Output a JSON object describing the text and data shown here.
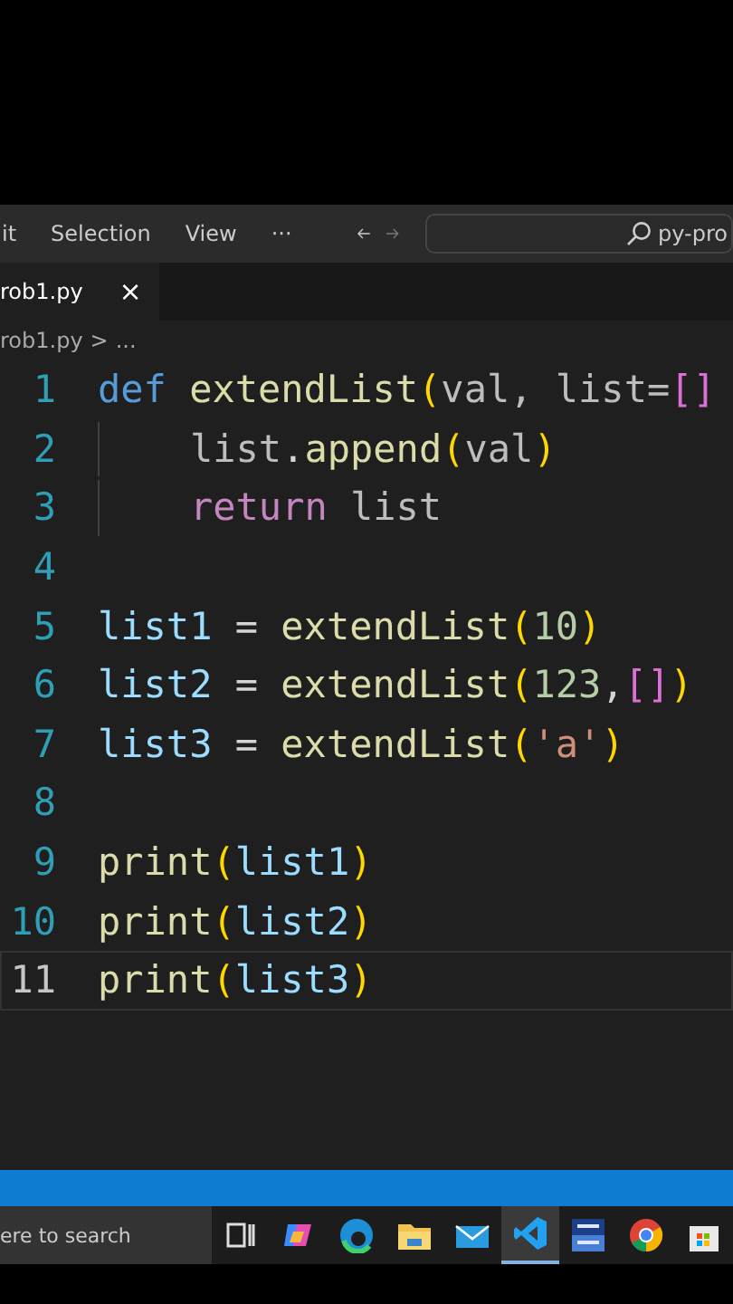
{
  "menu_bar": {
    "items": [
      "it",
      "Selection",
      "View",
      "···"
    ],
    "search": {
      "value": "py-pro"
    }
  },
  "tabs": [
    {
      "label": "rob1.py",
      "close": "×",
      "selected": true
    }
  ],
  "breadcrumb": {
    "file": "rob1.py",
    "separator": ">",
    "more": "..."
  },
  "editor": {
    "lines": [
      {
        "number": "1",
        "active": false,
        "indent": false,
        "tokens": [
          {
            "text": "def ",
            "kind": "keyword"
          },
          {
            "text": "extendList",
            "kind": "function"
          },
          {
            "text": "(",
            "kind": "paren"
          },
          {
            "text": "val, list=",
            "kind": "param"
          },
          {
            "text": "[]",
            "kind": "bracket"
          }
        ]
      },
      {
        "number": "2",
        "active": false,
        "indent": true,
        "tokens": [
          {
            "text": "list",
            "kind": "param"
          },
          {
            "text": ".",
            "kind": "plain"
          },
          {
            "text": "append",
            "kind": "function"
          },
          {
            "text": "(",
            "kind": "paren"
          },
          {
            "text": "val",
            "kind": "param"
          },
          {
            "text": ")",
            "kind": "paren"
          }
        ]
      },
      {
        "number": "3",
        "active": false,
        "indent": true,
        "tokens": [
          {
            "text": "return",
            "kind": "control"
          },
          {
            "text": " list",
            "kind": "param"
          }
        ]
      },
      {
        "number": "4",
        "active": false,
        "indent": false
      },
      {
        "number": "5",
        "active": false,
        "indent": false,
        "tokens": [
          {
            "text": "list1",
            "kind": "variable"
          },
          {
            "text": " = ",
            "kind": "plain"
          },
          {
            "text": "extendList",
            "kind": "function"
          },
          {
            "text": "(",
            "kind": "paren"
          },
          {
            "text": "10",
            "kind": "number"
          },
          {
            "text": ")",
            "kind": "paren"
          }
        ]
      },
      {
        "number": "6",
        "active": false,
        "indent": false,
        "tokens": [
          {
            "text": "list2",
            "kind": "variable"
          },
          {
            "text": " = ",
            "kind": "plain"
          },
          {
            "text": "extendList",
            "kind": "function"
          },
          {
            "text": "(",
            "kind": "paren"
          },
          {
            "text": "123",
            "kind": "number"
          },
          {
            "text": ",",
            "kind": "plain"
          },
          {
            "text": "[]",
            "kind": "bracket"
          },
          {
            "text": ")",
            "kind": "paren"
          }
        ]
      },
      {
        "number": "7",
        "active": false,
        "indent": false,
        "tokens": [
          {
            "text": "list3",
            "kind": "variable"
          },
          {
            "text": " = ",
            "kind": "plain"
          },
          {
            "text": "extendList",
            "kind": "function"
          },
          {
            "text": "(",
            "kind": "paren"
          },
          {
            "text": "'a'",
            "kind": "string"
          },
          {
            "text": ")",
            "kind": "paren"
          }
        ]
      },
      {
        "number": "8",
        "active": false,
        "indent": false
      },
      {
        "number": "9",
        "active": false,
        "indent": false,
        "tokens": [
          {
            "text": "print",
            "kind": "function"
          },
          {
            "text": "(",
            "kind": "paren"
          },
          {
            "text": "list1",
            "kind": "variable"
          },
          {
            "text": ")",
            "kind": "paren"
          }
        ]
      },
      {
        "number": "10",
        "active": false,
        "indent": false,
        "tokens": [
          {
            "text": "print",
            "kind": "function"
          },
          {
            "text": "(",
            "kind": "paren"
          },
          {
            "text": "list2",
            "kind": "variable"
          },
          {
            "text": ")",
            "kind": "paren"
          }
        ]
      },
      {
        "number": "11",
        "active": true,
        "indent": false,
        "tokens": [
          {
            "text": "print",
            "kind": "function"
          },
          {
            "text": "(",
            "kind": "paren"
          },
          {
            "text": "list3",
            "kind": "variable"
          },
          {
            "text": ")",
            "kind": "paren"
          }
        ]
      }
    ]
  },
  "taskbar": {
    "search": {
      "placeholder": "ere to search"
    },
    "apps": [
      {
        "kind": "taskview",
        "selected": false
      },
      {
        "kind": "copilot",
        "selected": false
      },
      {
        "kind": "edge",
        "selected": false
      },
      {
        "kind": "folder",
        "selected": false
      },
      {
        "kind": "mail",
        "selected": false
      },
      {
        "kind": "vscode",
        "selected": true
      },
      {
        "kind": "dev",
        "selected": false
      },
      {
        "kind": "chrome",
        "selected": false
      },
      {
        "kind": "store",
        "selected": false
      }
    ]
  }
}
